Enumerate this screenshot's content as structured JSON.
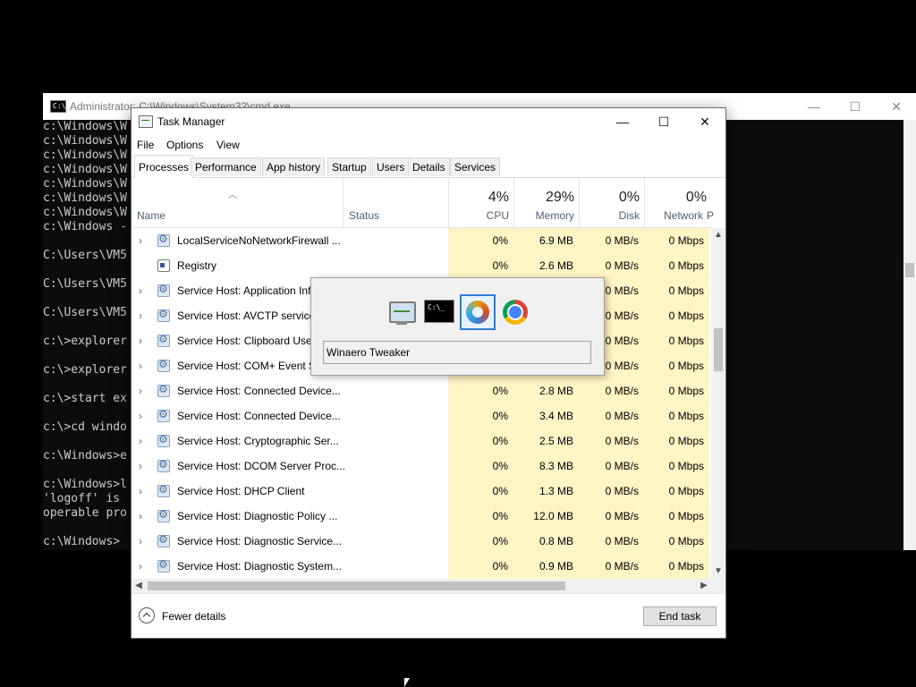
{
  "cmd": {
    "title": "Administrator: C:\\Windows\\System32\\cmd.exe",
    "icon_text": "C:\\",
    "controls": [
      "—",
      "☐",
      "✕"
    ],
    "lines": [
      "c:\\Windows\\W",
      "c:\\Windows\\W",
      "c:\\Windows\\W",
      "c:\\Windows\\W",
      "c:\\Windows\\W",
      "c:\\Windows\\W",
      "c:\\Windows\\W",
      "c:\\Windows -",
      "",
      "C:\\Users\\VM5",
      "",
      "C:\\Users\\VM5",
      "",
      "C:\\Users\\VM5",
      "",
      "c:\\>explorer",
      "",
      "c:\\>explorer",
      "",
      "c:\\>start ex",
      "",
      "c:\\>cd windo",
      "",
      "c:\\Windows>e",
      "",
      "c:\\Windows>l",
      "'logoff' is",
      "operable pro",
      "",
      "c:\\Windows>"
    ]
  },
  "taskmanager": {
    "title": "Task Manager",
    "window_controls": [
      "—",
      "☐",
      "✕"
    ],
    "menu": [
      "File",
      "Options",
      "View"
    ],
    "tabs": [
      "Processes",
      "Performance",
      "App history",
      "Startup",
      "Users",
      "Details",
      "Services"
    ],
    "active_tab": "Processes",
    "columns": {
      "name": "Name",
      "status": "Status",
      "cpu": {
        "pct": "4%",
        "label": "CPU"
      },
      "memory": {
        "pct": "29%",
        "label": "Memory"
      },
      "disk": {
        "pct": "0%",
        "label": "Disk"
      },
      "network": {
        "pct": "0%",
        "label": "Network"
      },
      "more": "P"
    },
    "rows": [
      {
        "name": "LocalServiceNoNetworkFirewall ...",
        "expand": true,
        "icon": "gear",
        "cpu": "0%",
        "mem": "6.9 MB",
        "disk": "0 MB/s",
        "net": "0 Mbps"
      },
      {
        "name": "Registry",
        "expand": false,
        "icon": "reg",
        "cpu": "0%",
        "mem": "2.6 MB",
        "disk": "0 MB/s",
        "net": "0 Mbps"
      },
      {
        "name": "Service Host: Application Inf",
        "expand": true,
        "icon": "gear",
        "cpu": "",
        "mem": "",
        "disk": "0 MB/s",
        "net": "0 Mbps"
      },
      {
        "name": "Service Host: AVCTP service",
        "expand": true,
        "icon": "gear",
        "cpu": "",
        "mem": "",
        "disk": "0 MB/s",
        "net": "0 Mbps"
      },
      {
        "name": "Service Host: Clipboard User",
        "expand": true,
        "icon": "gear",
        "cpu": "",
        "mem": "",
        "disk": "0 MB/s",
        "net": "0 Mbps"
      },
      {
        "name": "Service Host: COM+ Event Sy",
        "expand": true,
        "icon": "gear",
        "cpu": "",
        "mem": "",
        "disk": "0 MB/s",
        "net": "0 Mbps"
      },
      {
        "name": "Service Host: Connected Device...",
        "expand": true,
        "icon": "gear",
        "cpu": "0%",
        "mem": "2.8 MB",
        "disk": "0 MB/s",
        "net": "0 Mbps"
      },
      {
        "name": "Service Host: Connected Device...",
        "expand": true,
        "icon": "gear",
        "cpu": "0%",
        "mem": "3.4 MB",
        "disk": "0 MB/s",
        "net": "0 Mbps"
      },
      {
        "name": "Service Host: Cryptographic Ser...",
        "expand": true,
        "icon": "gear",
        "cpu": "0%",
        "mem": "2.5 MB",
        "disk": "0 MB/s",
        "net": "0 Mbps"
      },
      {
        "name": "Service Host: DCOM Server Proc...",
        "expand": true,
        "icon": "gear",
        "cpu": "0%",
        "mem": "8.3 MB",
        "disk": "0 MB/s",
        "net": "0 Mbps"
      },
      {
        "name": "Service Host: DHCP Client",
        "expand": true,
        "icon": "gear",
        "cpu": "0%",
        "mem": "1.3 MB",
        "disk": "0 MB/s",
        "net": "0 Mbps"
      },
      {
        "name": "Service Host: Diagnostic Policy ...",
        "expand": true,
        "icon": "gear",
        "cpu": "0%",
        "mem": "12.0 MB",
        "disk": "0 MB/s",
        "net": "0 Mbps"
      },
      {
        "name": "Service Host: Diagnostic Service...",
        "expand": true,
        "icon": "gear",
        "cpu": "0%",
        "mem": "0.8 MB",
        "disk": "0 MB/s",
        "net": "0 Mbps"
      },
      {
        "name": "Service Host: Diagnostic System...",
        "expand": true,
        "icon": "gear",
        "cpu": "0%",
        "mem": "0.9 MB",
        "disk": "0 MB/s",
        "net": "0 Mbps"
      }
    ],
    "fewer_details": "Fewer details",
    "end_task": "End task"
  },
  "alttab": {
    "icons": [
      "task-manager-icon",
      "cmd-icon",
      "winaero-tweaker-icon",
      "chrome-icon"
    ],
    "selected": "winaero-tweaker-icon",
    "cmd_icon_text": "C:\\_",
    "label": "Winaero Tweaker"
  },
  "colors": {
    "heat_cell": "#fff4c4",
    "selection": "#2f7bd6",
    "console_bg": "#0c0c0c"
  }
}
